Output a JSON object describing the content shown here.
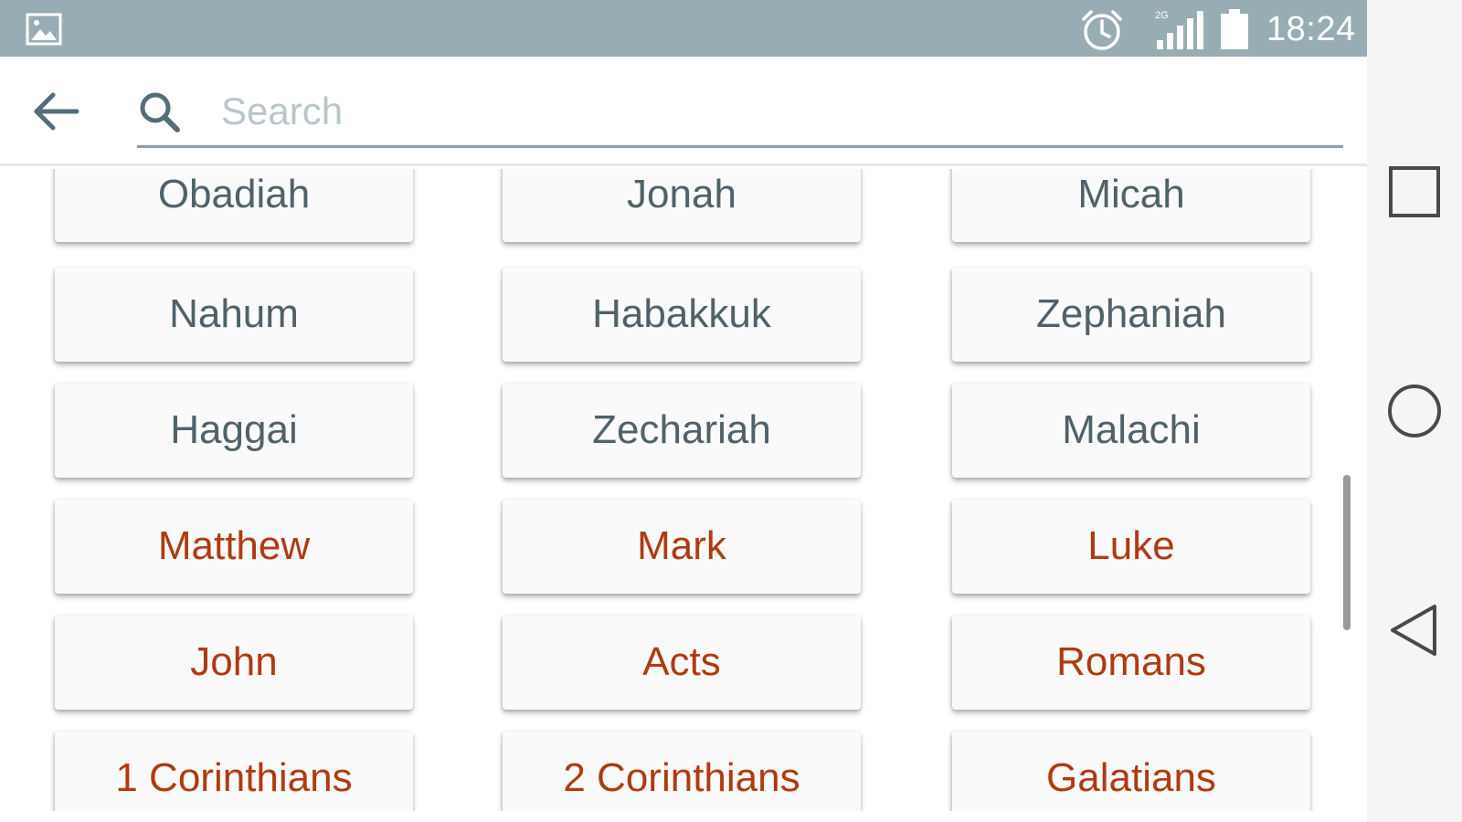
{
  "status_bar": {
    "time": "18:24",
    "icons": [
      "image-notification-icon",
      "alarm-icon",
      "signal-icon",
      "battery-icon"
    ],
    "background": "#98adb3"
  },
  "search": {
    "placeholder": "Search",
    "value": ""
  },
  "books": {
    "rows": [
      [
        {
          "label": "Obadiah",
          "testament": "old"
        },
        {
          "label": "Jonah",
          "testament": "old"
        },
        {
          "label": "Micah",
          "testament": "old"
        }
      ],
      [
        {
          "label": "Nahum",
          "testament": "old"
        },
        {
          "label": "Habakkuk",
          "testament": "old"
        },
        {
          "label": "Zephaniah",
          "testament": "old"
        }
      ],
      [
        {
          "label": "Haggai",
          "testament": "old"
        },
        {
          "label": "Zechariah",
          "testament": "old"
        },
        {
          "label": "Malachi",
          "testament": "old"
        }
      ],
      [
        {
          "label": "Matthew",
          "testament": "new"
        },
        {
          "label": "Mark",
          "testament": "new"
        },
        {
          "label": "Luke",
          "testament": "new"
        }
      ],
      [
        {
          "label": "John",
          "testament": "new"
        },
        {
          "label": "Acts",
          "testament": "new"
        },
        {
          "label": "Romans",
          "testament": "new"
        }
      ],
      [
        {
          "label": "1 Corinthians",
          "testament": "new"
        },
        {
          "label": "2 Corinthians",
          "testament": "new"
        },
        {
          "label": "Galatians",
          "testament": "new"
        }
      ]
    ]
  },
  "colors": {
    "old_testament_text": "#4f6269",
    "new_testament_text": "#b03a12",
    "search_underline": "#8aa0a6"
  },
  "nav_bar": {
    "buttons": [
      "recent-apps-icon",
      "home-icon",
      "back-nav-icon"
    ]
  }
}
